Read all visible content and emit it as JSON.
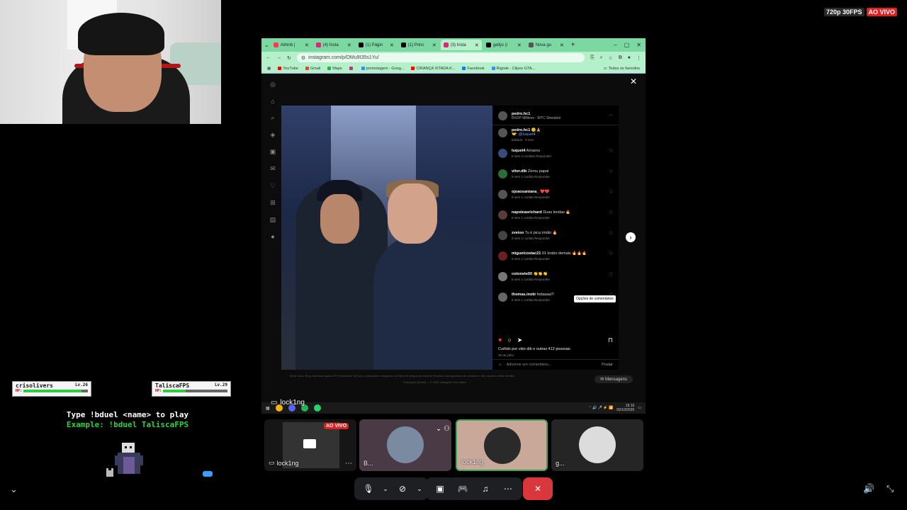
{
  "stream": {
    "quality": "720p 30FPS",
    "live": "AO VIVO"
  },
  "browser": {
    "tabs": [
      {
        "label": "Airbnb |",
        "color": "#ff385c",
        "active": false
      },
      {
        "label": "(4) Insta",
        "color": "#d62976",
        "active": false
      },
      {
        "label": "(1) Págin",
        "color": "#000000",
        "active": false
      },
      {
        "label": "(1) Princ",
        "color": "#000000",
        "active": false
      },
      {
        "label": "(3) Insta",
        "color": "#d62976",
        "active": true
      },
      {
        "label": "gallys (i",
        "color": "#000000",
        "active": false
      },
      {
        "label": "Nova gu",
        "color": "#555555",
        "active": false
      }
    ],
    "url": "instagram.com/p/DMu9I35s1Yu/",
    "bookmarks": [
      {
        "label": "YouTube",
        "color": "#ff0000"
      },
      {
        "label": "Gmail",
        "color": "#ea4335"
      },
      {
        "label": "Maps",
        "color": "#34a853"
      },
      {
        "label": "",
        "color": "#d62976"
      },
      {
        "label": "promotagem - Goog...",
        "color": "#4285f4"
      },
      {
        "label": "CRIANÇA XITADA K...",
        "color": "#ff0000"
      },
      {
        "label": "Facebook",
        "color": "#1877f2"
      },
      {
        "label": "Rigode - Clipes GTA...",
        "color": "#4285f4"
      }
    ],
    "bookmarks_all": "Todos os favoritos"
  },
  "post": {
    "author": {
      "name": "pedro.hc1",
      "location": "BSOP Millions - WTC Sheraton"
    },
    "caption": {
      "name": "pedro.hc1",
      "text": "😊🙏",
      "tag": "🤝: @luquet4",
      "meta": "Editado · 9 sem"
    },
    "comments": [
      {
        "user": "luquet4",
        "text": "Arrasou",
        "meta": "9 sem   2 curtidas   Responder",
        "color": "#3b4a7a"
      },
      {
        "user": "vitor.dib",
        "text": "Zerou papai",
        "meta": "9 sem   1 curtida   Responder",
        "color": "#2e6b3a"
      },
      {
        "user": "ojoaosantana_",
        "text": "❤️❤️",
        "meta": "9 sem   1 curtida   Responder",
        "color": "#555555"
      },
      {
        "user": "napoleaorichard",
        "text": "Duas lendas 🔥",
        "meta": "9 sem   1 curtida   Responder",
        "color": "#5a3a3a"
      },
      {
        "user": "zveioo",
        "text": "Tu é pica irmão 🔥",
        "meta": "9 sem   1 curtida   Responder",
        "color": "#444444"
      },
      {
        "user": "miguelcostac21",
        "text": "01 brabo demais 🔥🔥🔥",
        "meta": "9 sem   1 curtida   Responder",
        "color": "#6a2020"
      },
      {
        "user": "cotonete00",
        "text": "👏👏👏",
        "meta": "9 sem   1 curtida   Responder",
        "color": "#777777"
      },
      {
        "user": "thomas.inoki",
        "text": "fodaaaa!!!",
        "meta": "9 sem   1 curtida   Responder",
        "color": "#666666"
      }
    ],
    "likes": "Curtido por vitor.dib e outras 412 pessoas",
    "date": "30 de julho",
    "add_comment": "Adicione um comentário...",
    "post_button": "Postar",
    "tooltip": "Opções de comentários",
    "messages": "Mensagens",
    "footer": "Meta   Sobre   Blog   Carreiras   Ajuda   API   Privacidade   Termos   Localizações   Instagram Lite   Meta AI   Artigos da Meta AI   Threads   Carregamento de contatos e não usuários   Meta Verified",
    "footer2": "Português (Brasil) ⌄   © 2025 Instagram from Meta"
  },
  "taskbar": {
    "time": "16:16",
    "date": "02/10/2025"
  },
  "streamer_name": "lock1ng",
  "game": {
    "player1": {
      "name": "crisolivers",
      "level": "Lv.26",
      "hp": 0.9
    },
    "player2": {
      "name": "TaliscaFPS",
      "level": "Lv.29",
      "hp": 0.35
    },
    "hp_label": "HP:",
    "line1": "Type !bduel <name> to play",
    "line2": "Example: !bduel TaliscaFPS"
  },
  "tiles": [
    {
      "label": "lock1ng",
      "live": "AO VIVO"
    },
    {
      "label": "B..."
    },
    {
      "label": "lock1ng"
    },
    {
      "label": "g..."
    }
  ]
}
